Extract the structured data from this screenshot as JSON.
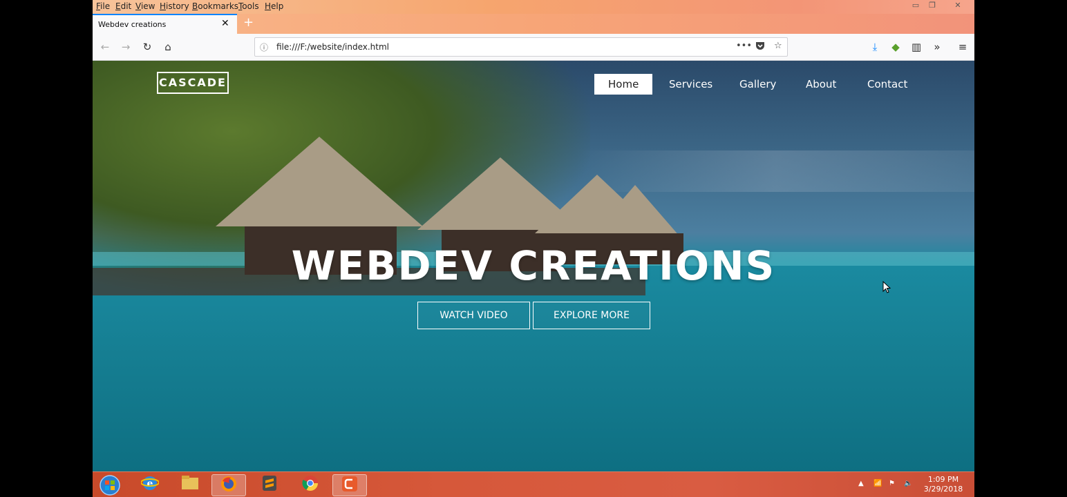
{
  "browser": {
    "menu": [
      "File",
      "Edit",
      "View",
      "History",
      "Bookmarks",
      "Tools",
      "Help"
    ],
    "window_controls": [
      "minimize-icon",
      "restore-icon",
      "close-icon"
    ],
    "tab": {
      "title": "Webdev creations",
      "close": "✕"
    },
    "new_tab": "+",
    "url": "file:///F:/website/index.html",
    "url_actions": [
      "•••",
      "pocket-icon",
      "star-icon"
    ],
    "toolbar_right": [
      "download-icon",
      "addon-icon",
      "sidebar-icon",
      "overflow-icon",
      "menu-icon"
    ],
    "colors": {
      "accent": "#0a84ff"
    }
  },
  "site": {
    "logo": "CASCADE",
    "nav": [
      "Home",
      "Services",
      "Gallery",
      "About",
      "Contact"
    ],
    "active_nav": "Home",
    "hero_title": "WEBDEV CREATIONS",
    "buttons": {
      "watch": "WATCH VIDEO",
      "explore": "EXPLORE MORE"
    }
  },
  "taskbar": {
    "apps": [
      "start-orb-icon",
      "internet-explorer-icon",
      "file-explorer-icon",
      "firefox-icon",
      "sublime-text-icon",
      "chrome-icon",
      "camtasia-icon"
    ],
    "time": "1:09 PM",
    "date": "3/29/2018"
  }
}
